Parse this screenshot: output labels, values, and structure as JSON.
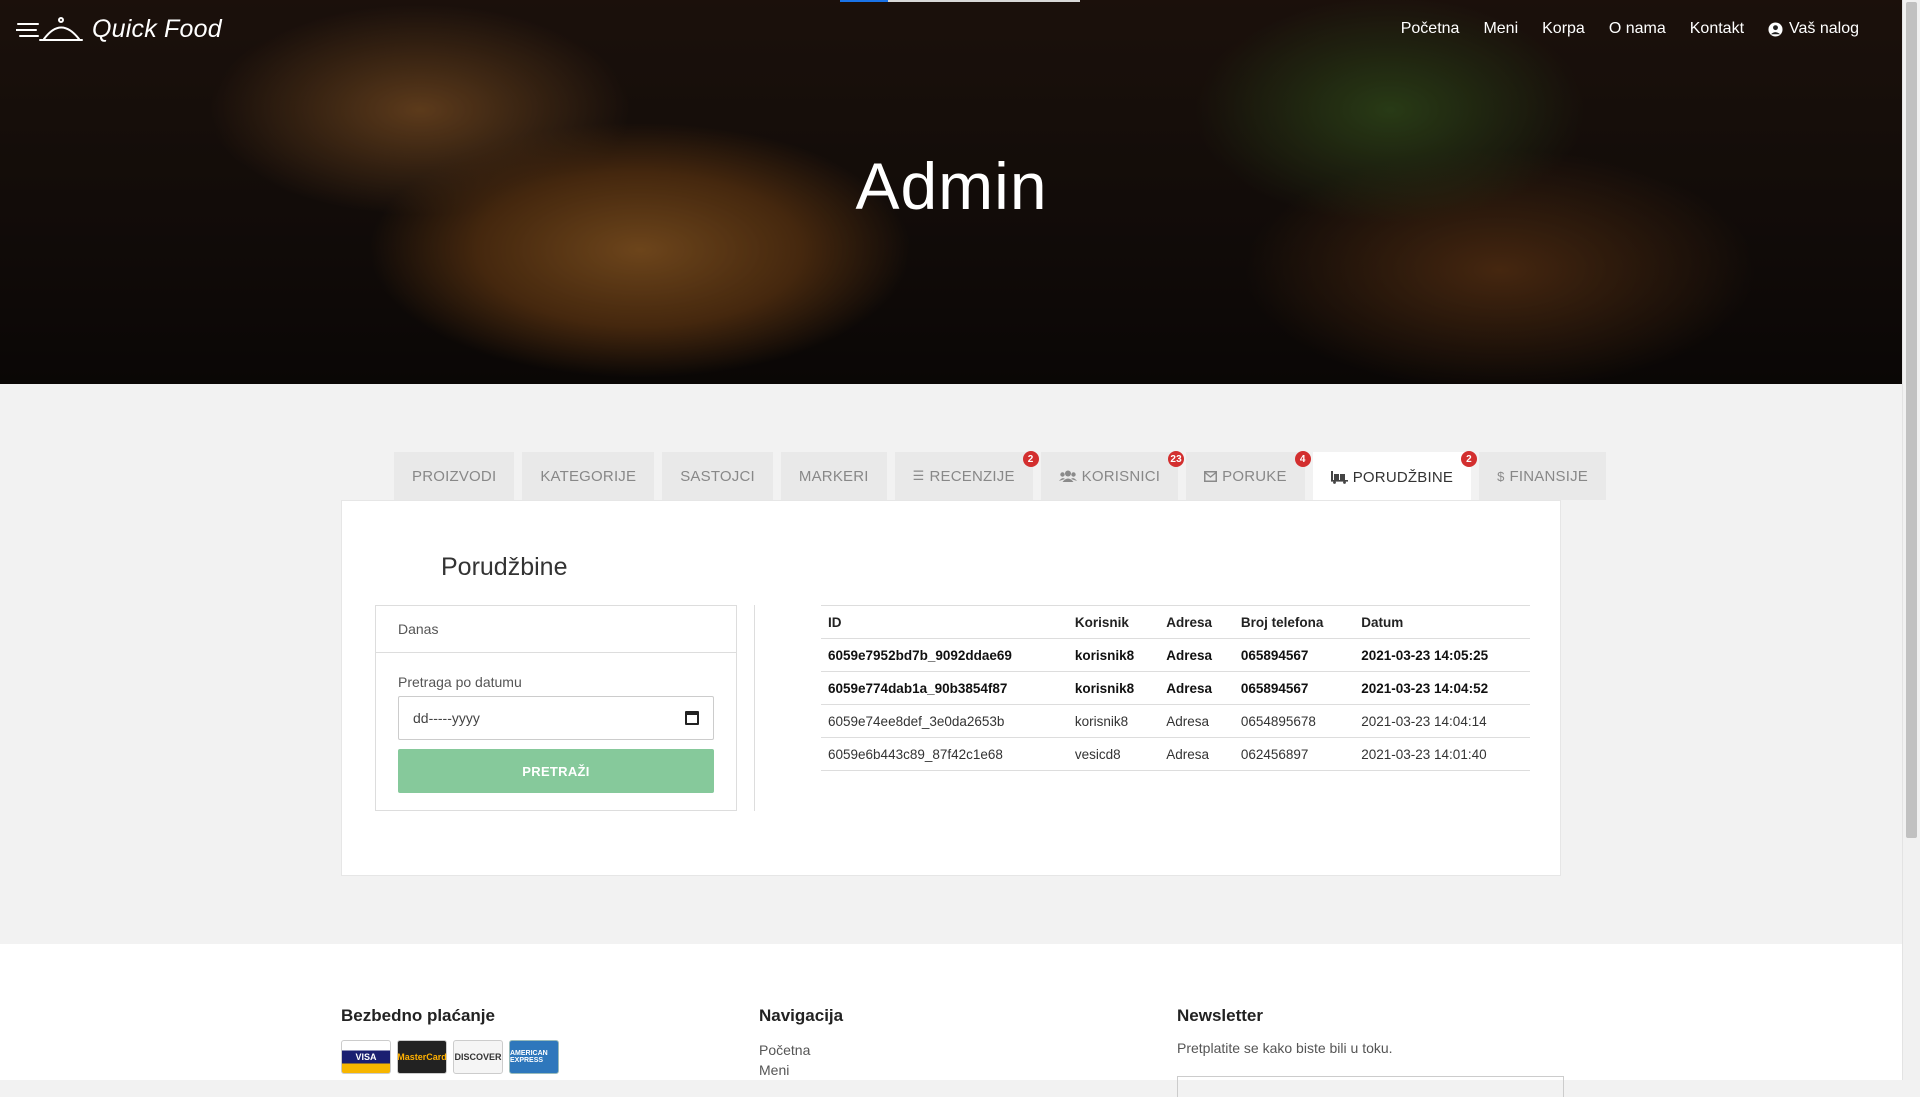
{
  "brand": {
    "name": "Quick Food"
  },
  "nav": {
    "items": [
      "Početna",
      "Meni",
      "Korpa",
      "O nama",
      "Kontakt"
    ],
    "account": "Vaš nalog"
  },
  "hero": {
    "title": "Admin"
  },
  "tabs": [
    {
      "label": "PROIZVODI",
      "icon": "",
      "badge": ""
    },
    {
      "label": "KATEGORIJE",
      "icon": "",
      "badge": ""
    },
    {
      "label": "SASTOJCI",
      "icon": "",
      "badge": ""
    },
    {
      "label": "MARKERI",
      "icon": "",
      "badge": ""
    },
    {
      "label": "RECENZIJE",
      "icon": "list-icon",
      "badge": "2"
    },
    {
      "label": "KORISNICI",
      "icon": "users-icon",
      "badge": "23"
    },
    {
      "label": "PORUKE",
      "icon": "envelope-icon",
      "badge": "4"
    },
    {
      "label": "PORUDŽBINE",
      "icon": "truck-icon",
      "badge": "2"
    },
    {
      "label": "FINANSIJE",
      "icon": "dollar-icon",
      "badge": ""
    }
  ],
  "active_tab": "PORUDŽBINE",
  "orders": {
    "title": "Porudžbine",
    "filter": {
      "header": "Danas",
      "date_label": "Pretraga po datumu",
      "date_placeholder": "dd-----yyyy",
      "search_button": "PRETRAŽI"
    },
    "columns": [
      "ID",
      "Korisnik",
      "Adresa",
      "Broj telefona",
      "Datum"
    ],
    "rows": [
      {
        "id": "6059e7952bd7b_9092ddae69",
        "user": "korisnik8",
        "address": "Adresa",
        "phone": "065894567",
        "date": "2021-03-23 14:05:25",
        "unread": true
      },
      {
        "id": "6059e774dab1a_90b3854f87",
        "user": "korisnik8",
        "address": "Adresa",
        "phone": "065894567",
        "date": "2021-03-23 14:04:52",
        "unread": true
      },
      {
        "id": "6059e74ee8def_3e0da2653b",
        "user": "korisnik8",
        "address": "Adresa",
        "phone": "0654895678",
        "date": "2021-03-23 14:04:14",
        "unread": false
      },
      {
        "id": "6059e6b443c89_87f42c1e68",
        "user": "vesicd8",
        "address": "Adresa",
        "phone": "062456897",
        "date": "2021-03-23 14:01:40",
        "unread": false
      }
    ]
  },
  "footer": {
    "payment_title": "Bezbedno plaćanje",
    "cards": [
      "VISA",
      "MasterCard",
      "DISCOVER",
      "AMERICAN EXPRESS"
    ],
    "nav_title": "Navigacija",
    "nav_links": [
      "Početna",
      "Meni"
    ],
    "newsletter_title": "Newsletter",
    "newsletter_text": "Pretplatite se kako biste bili u toku."
  },
  "colors": {
    "accent_green": "#86c99b",
    "badge_red": "#d32f2f"
  }
}
